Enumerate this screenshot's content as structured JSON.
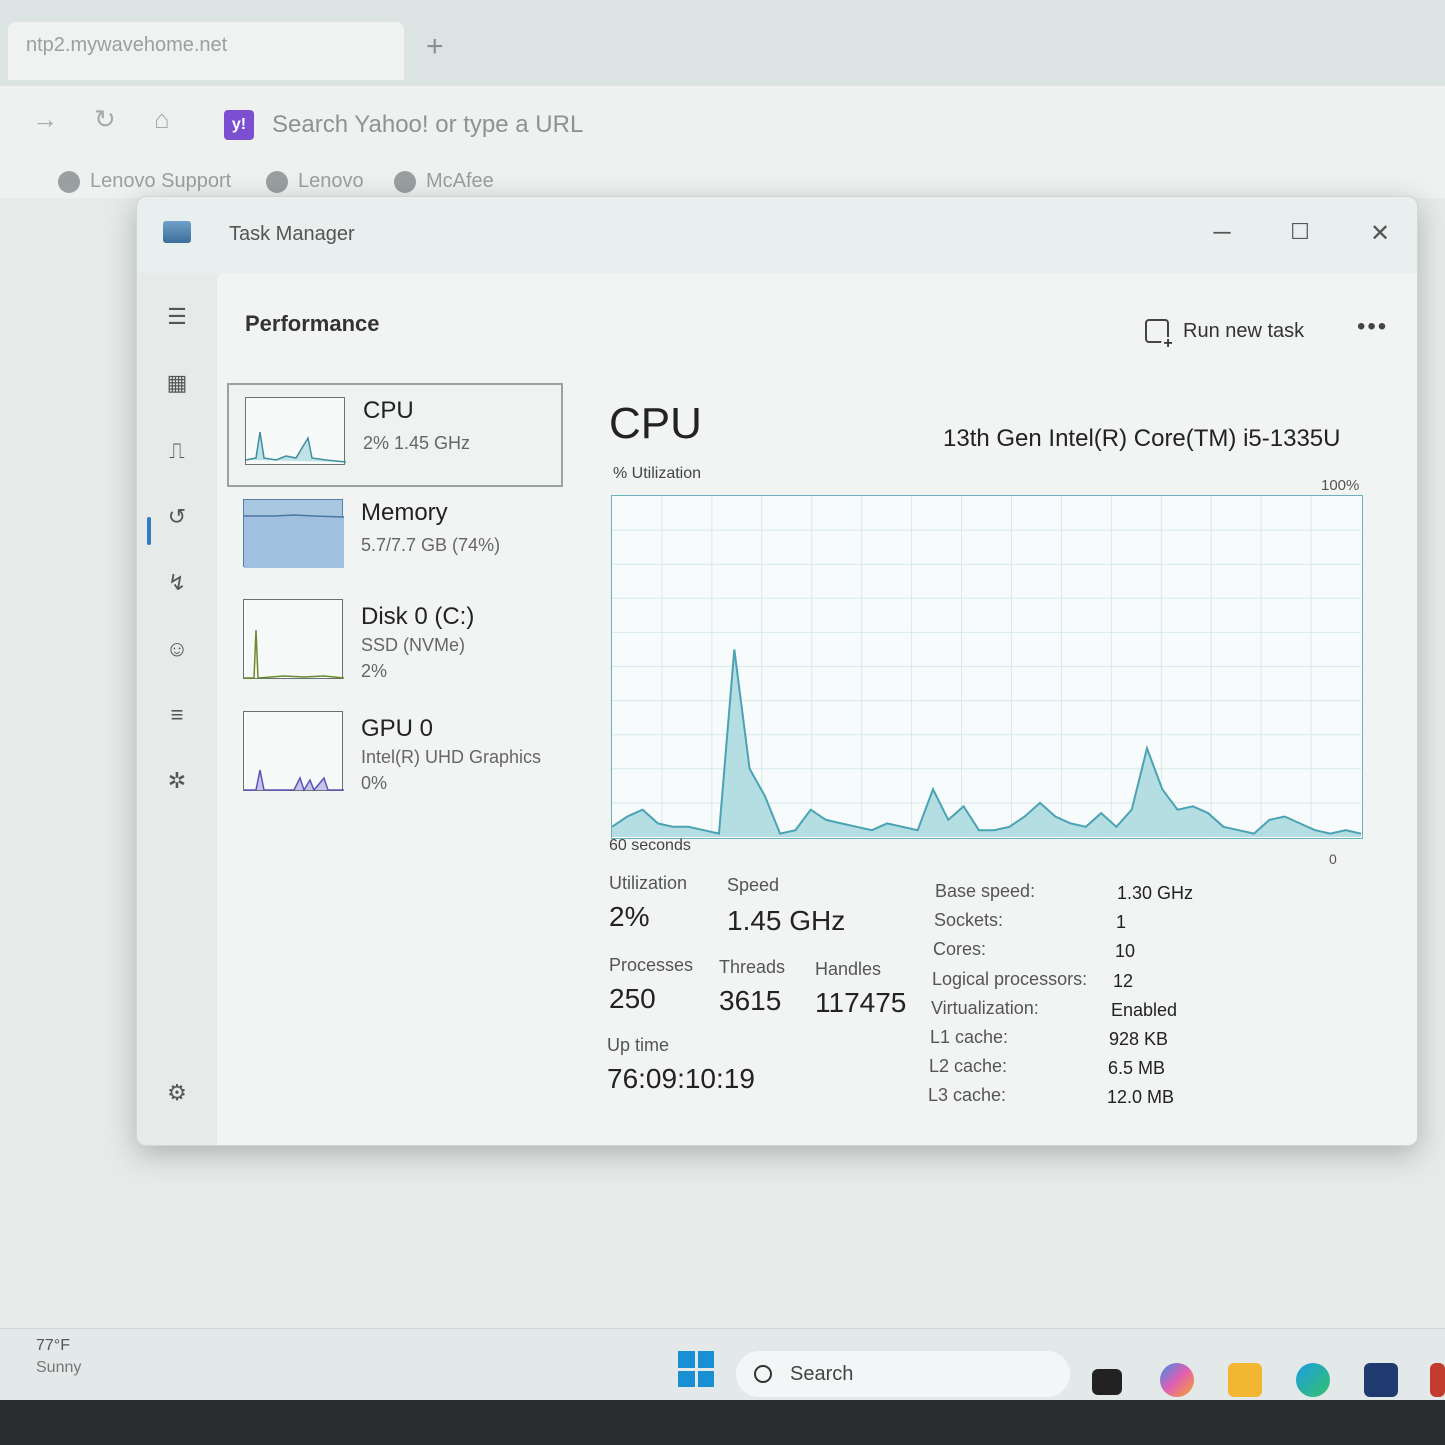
{
  "browser": {
    "tab_title": "ntp2.mywavehome.net",
    "new_tab_icon": "plus-icon",
    "url_placeholder": "Search Yahoo! or type a URL",
    "bookmarks": [
      "Lenovo Support",
      "Lenovo",
      "McAfee"
    ]
  },
  "task_manager": {
    "title": "Task Manager",
    "page_title": "Performance",
    "run_new_task": "Run new task",
    "more": "•••",
    "resources": [
      {
        "name": "CPU",
        "line1": "2%  1.45 GHz",
        "line2": ""
      },
      {
        "name": "Memory",
        "line1": "5.7/7.7 GB (74%)",
        "line2": ""
      },
      {
        "name": "Disk 0 (C:)",
        "line1": "SSD (NVMe)",
        "line2": "2%"
      },
      {
        "name": "GPU 0",
        "line1": "Intel(R) UHD Graphics",
        "line2": "0%"
      }
    ],
    "detail": {
      "title": "CPU",
      "model": "13th Gen Intel(R) Core(TM) i5-1335U",
      "graph_label": "% Utilization",
      "max_label": "100%",
      "time_label": "60 seconds",
      "min_label": "0",
      "stats": {
        "utilization_label": "Utilization",
        "utilization": "2%",
        "speed_label": "Speed",
        "speed": "1.45 GHz",
        "processes_label": "Processes",
        "processes": "250",
        "threads_label": "Threads",
        "threads": "3615",
        "handles_label": "Handles",
        "handles": "117475",
        "uptime_label": "Up time",
        "uptime": "76:09:10:19"
      },
      "info": [
        {
          "label": "Base speed:",
          "value": "1.30 GHz"
        },
        {
          "label": "Sockets:",
          "value": "1"
        },
        {
          "label": "Cores:",
          "value": "10"
        },
        {
          "label": "Logical processors:",
          "value": "12"
        },
        {
          "label": "Virtualization:",
          "value": "Enabled"
        },
        {
          "label": "L1 cache:",
          "value": "928 KB"
        },
        {
          "label": "L2 cache:",
          "value": "6.5 MB"
        },
        {
          "label": "L3 cache:",
          "value": "12.0 MB"
        }
      ]
    },
    "cpu_history_percent": [
      3,
      6,
      8,
      4,
      3,
      3,
      2,
      1,
      55,
      20,
      12,
      1,
      2,
      8,
      5,
      4,
      3,
      2,
      4,
      3,
      2,
      14,
      5,
      9,
      2,
      2,
      3,
      6,
      10,
      6,
      4,
      3,
      7,
      3,
      8,
      26,
      14,
      8,
      9,
      7,
      3,
      2,
      1,
      5,
      6,
      4,
      2,
      1,
      2,
      1
    ]
  },
  "taskbar": {
    "weather_temp": "77°F",
    "weather_desc": "Sunny",
    "search_label": "Search"
  },
  "colors": {
    "graph_line": "#4aa3b5",
    "graph_fill": "#a9d8de",
    "accent": "#2f7fc0"
  }
}
